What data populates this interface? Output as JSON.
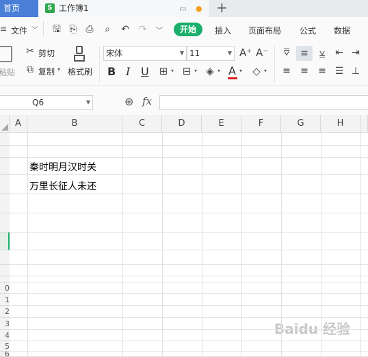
{
  "tabs": {
    "home": "首页",
    "document": "工作簿1",
    "doc_icon": "S",
    "add": "+"
  },
  "menu": {
    "file": "文件",
    "start": "开始",
    "items": [
      "插入",
      "页面布局",
      "公式",
      "数据"
    ]
  },
  "ribbon": {
    "paste": "粘贴",
    "cut": "剪切",
    "copy": "复制",
    "format_painter": "格式刷",
    "font_name": "宋体",
    "font_size": "11",
    "bold": "B",
    "italic": "I",
    "underline": "U"
  },
  "formula_bar": {
    "name_box": "Q6",
    "fx": "fx",
    "value": ""
  },
  "sheet": {
    "columns": [
      "A",
      "B",
      "C",
      "D",
      "E",
      "F",
      "G",
      "H"
    ],
    "row_labels": [
      "",
      "",
      "",
      "",
      "",
      "",
      "",
      "",
      "",
      "",
      "0",
      "1",
      "2",
      "3",
      "4",
      "5",
      "6"
    ],
    "cells": {
      "B3": "秦时明月汉时关",
      "B4": "万里长征人未还"
    }
  },
  "watermark": "Baidu 经验",
  "colors": {
    "accent_green": "#1aaf6a",
    "home_tab_blue": "#4a7fd8",
    "sheet_icon_green": "#2fa84f",
    "font_color_red": "#e02020",
    "active_row_green": "#1aaf6a"
  }
}
